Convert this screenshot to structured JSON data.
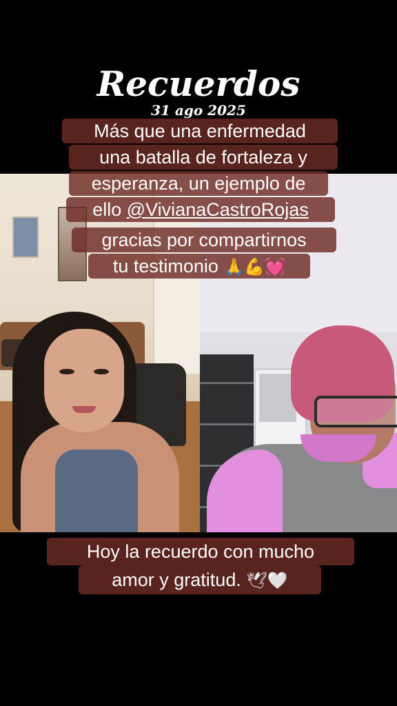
{
  "header": {
    "title": "Recuerdos",
    "date": "31 ago 2025"
  },
  "caption_top": {
    "line1": "Más que una enfermedad",
    "line2": "una batalla de fortaleza y",
    "line3": "esperanza, un ejemplo de",
    "line4_prefix": "ello ",
    "line4_mention": "@VivianaCastroRojas",
    "line5": "gracias por compartirnos",
    "line6": "tu testimonio",
    "emojis": [
      "pray-icon",
      "muscle-icon",
      "pink-heart-icon"
    ],
    "emoji_glyphs": {
      "pray": "🙏",
      "muscle": "💪",
      "heart": "💓"
    }
  },
  "caption_bottom": {
    "line1": "Hoy la recuerdo con mucho",
    "line2": "amor y gratitud.",
    "emojis": [
      "dove-icon",
      "white-heart-icon"
    ],
    "emoji_glyphs": {
      "dove": "🕊",
      "heart": "🤍"
    }
  },
  "colors": {
    "caption_bg": "#6e2c24",
    "text": "#ffffff",
    "background": "#000000"
  }
}
